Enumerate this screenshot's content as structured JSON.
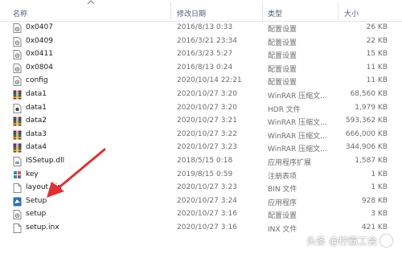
{
  "columns": {
    "name": "名称",
    "date": "修改日期",
    "type": "类型",
    "size": "大小"
  },
  "files": [
    {
      "name": "0x0407",
      "date": "2016/8/13 0:33",
      "type": "配置设置",
      "size": "26 KB",
      "icon": "config-file-icon"
    },
    {
      "name": "0x0409",
      "date": "2016/3/21 23:34",
      "type": "配置设置",
      "size": "22 KB",
      "icon": "config-file-icon"
    },
    {
      "name": "0x0411",
      "date": "2016/3/23 5:27",
      "type": "配置设置",
      "size": "15 KB",
      "icon": "config-file-icon"
    },
    {
      "name": "0x0804",
      "date": "2016/8/13 0:24",
      "type": "配置设置",
      "size": "11 KB",
      "icon": "config-file-icon"
    },
    {
      "name": "config",
      "date": "2020/10/14 22:21",
      "type": "配置设置",
      "size": "11 KB",
      "icon": "config-file-icon"
    },
    {
      "name": "data1",
      "date": "2020/10/27 3:20",
      "type": "WinRAR 压缩文...",
      "size": "68,560 KB",
      "icon": "winrar-archive-icon"
    },
    {
      "name": "data1",
      "date": "2020/10/27 3:20",
      "type": "HDR 文件",
      "size": "1,979 KB",
      "icon": "hdr-file-icon"
    },
    {
      "name": "data2",
      "date": "2020/10/27 3:21",
      "type": "WinRAR 压缩文...",
      "size": "593,362 KB",
      "icon": "winrar-archive-icon"
    },
    {
      "name": "data3",
      "date": "2020/10/27 3:22",
      "type": "WinRAR 压缩文...",
      "size": "666,000 KB",
      "icon": "winrar-archive-icon"
    },
    {
      "name": "data4",
      "date": "2020/10/27 3:23",
      "type": "WinRAR 压缩文...",
      "size": "344,906 KB",
      "icon": "winrar-archive-icon"
    },
    {
      "name": "ISSetup.dll",
      "date": "2018/5/15 0:18",
      "type": "应用程序扩展",
      "size": "1,587 KB",
      "icon": "dll-file-icon"
    },
    {
      "name": "key",
      "date": "2019/8/15 0:59",
      "type": "注册表项",
      "size": "1 KB",
      "icon": "registry-file-icon"
    },
    {
      "name": "layout.bin",
      "date": "2020/10/27 3:23",
      "type": "BIN 文件",
      "size": "1 KB",
      "icon": "bin-file-icon"
    },
    {
      "name": "Setup",
      "date": "2020/10/27 3:24",
      "type": "应用程序",
      "size": "928 KB",
      "icon": "setup-exe-icon"
    },
    {
      "name": "setup",
      "date": "2020/10/27 3:16",
      "type": "配置设置",
      "size": "3 KB",
      "icon": "config-file-icon"
    },
    {
      "name": "setup.inx",
      "date": "2020/10/27 3:16",
      "type": "INX 文件",
      "size": "421 KB",
      "icon": "inx-file-icon"
    }
  ],
  "watermark": "头条 @柠霸工会",
  "colors": {
    "arrow": "#e03030",
    "winrar_red": "#b8202a",
    "header_text": "#4c607a"
  }
}
